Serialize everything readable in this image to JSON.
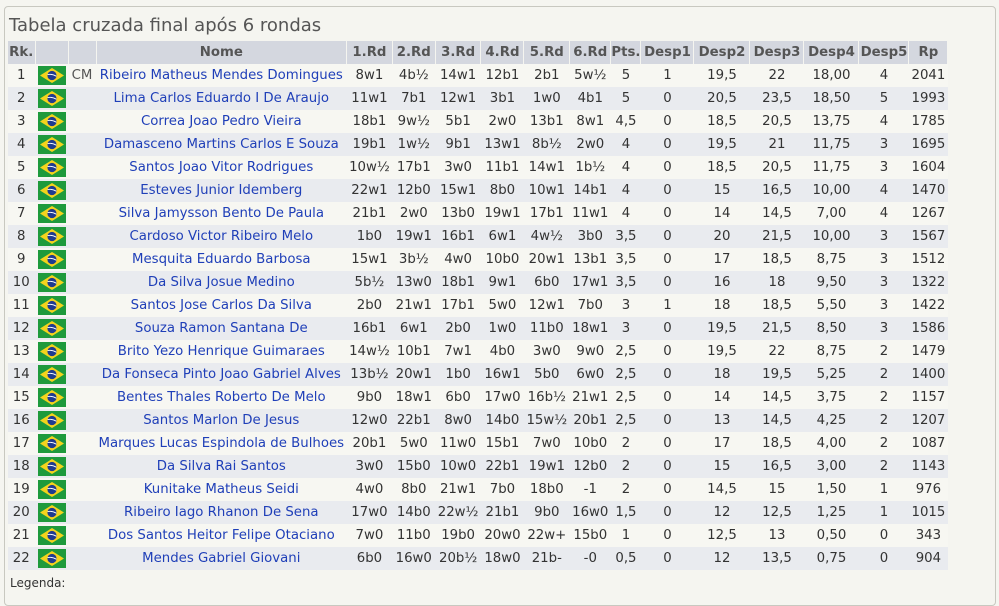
{
  "title": "Tabela cruzada final após 6 rondas",
  "headers": {
    "rank": "Rk.",
    "name": "Nome",
    "r1": "1.Rd",
    "r2": "2.Rd",
    "r3": "3.Rd",
    "r4": "4.Rd",
    "r5": "5.Rd",
    "r6": "6.Rd",
    "pts": "Pts.",
    "d1": "Desp1",
    "d2": "Desp2",
    "d3": "Desp3",
    "d4": "Desp4",
    "d5": "Desp5",
    "rp": "Rp"
  },
  "flag_icon": "brazil-flag-icon",
  "colors": {
    "header_bg": "#d4d7df",
    "link": "#1f3fb8",
    "row_alt": "#e9ebef"
  },
  "rows": [
    {
      "rk": "1",
      "title": "CM",
      "name": "Ribeiro Matheus Mendes Domingues",
      "rounds": [
        "8w1",
        "4b½",
        "14w1",
        "12b1",
        "2b1",
        "5w½"
      ],
      "pts": "5",
      "d1": "1",
      "d2": "19,5",
      "d3": "22",
      "d4": "18,00",
      "d5": "4",
      "rp": "2041"
    },
    {
      "rk": "2",
      "title": "",
      "name": "Lima Carlos Eduardo I De Araujo",
      "rounds": [
        "11w1",
        "7b1",
        "12w1",
        "3b1",
        "1w0",
        "4b1"
      ],
      "pts": "5",
      "d1": "0",
      "d2": "20,5",
      "d3": "23,5",
      "d4": "18,50",
      "d5": "5",
      "rp": "1993"
    },
    {
      "rk": "3",
      "title": "",
      "name": "Correa Joao Pedro Vieira",
      "rounds": [
        "18b1",
        "9w½",
        "5b1",
        "2w0",
        "13b1",
        "8w1"
      ],
      "pts": "4,5",
      "d1": "0",
      "d2": "18,5",
      "d3": "20,5",
      "d4": "13,75",
      "d5": "4",
      "rp": "1785"
    },
    {
      "rk": "4",
      "title": "",
      "name": "Damasceno Martins Carlos E Souza",
      "rounds": [
        "19b1",
        "1w½",
        "9b1",
        "13w1",
        "8b½",
        "2w0"
      ],
      "pts": "4",
      "d1": "0",
      "d2": "19,5",
      "d3": "21",
      "d4": "11,75",
      "d5": "3",
      "rp": "1695"
    },
    {
      "rk": "5",
      "title": "",
      "name": "Santos Joao Vitor Rodrigues",
      "rounds": [
        "10w½",
        "17b1",
        "3w0",
        "11b1",
        "14w1",
        "1b½"
      ],
      "pts": "4",
      "d1": "0",
      "d2": "18,5",
      "d3": "20,5",
      "d4": "11,75",
      "d5": "3",
      "rp": "1604"
    },
    {
      "rk": "6",
      "title": "",
      "name": "Esteves Junior Idemberg",
      "rounds": [
        "22w1",
        "12b0",
        "15w1",
        "8b0",
        "10w1",
        "14b1"
      ],
      "pts": "4",
      "d1": "0",
      "d2": "15",
      "d3": "16,5",
      "d4": "10,00",
      "d5": "4",
      "rp": "1470"
    },
    {
      "rk": "7",
      "title": "",
      "name": "Silva Jamysson Bento De Paula",
      "rounds": [
        "21b1",
        "2w0",
        "13b0",
        "19w1",
        "17b1",
        "11w1"
      ],
      "pts": "4",
      "d1": "0",
      "d2": "14",
      "d3": "14,5",
      "d4": "7,00",
      "d5": "4",
      "rp": "1267"
    },
    {
      "rk": "8",
      "title": "",
      "name": "Cardoso Victor Ribeiro Melo",
      "rounds": [
        "1b0",
        "19w1",
        "16b1",
        "6w1",
        "4w½",
        "3b0"
      ],
      "pts": "3,5",
      "d1": "0",
      "d2": "20",
      "d3": "21,5",
      "d4": "10,00",
      "d5": "3",
      "rp": "1567"
    },
    {
      "rk": "9",
      "title": "",
      "name": "Mesquita Eduardo Barbosa",
      "rounds": [
        "15w1",
        "3b½",
        "4w0",
        "10b0",
        "20w1",
        "13b1"
      ],
      "pts": "3,5",
      "d1": "0",
      "d2": "17",
      "d3": "18,5",
      "d4": "8,75",
      "d5": "3",
      "rp": "1512"
    },
    {
      "rk": "10",
      "title": "",
      "name": "Da Silva Josue Medino",
      "rounds": [
        "5b½",
        "13w0",
        "18b1",
        "9w1",
        "6b0",
        "17w1"
      ],
      "pts": "3,5",
      "d1": "0",
      "d2": "16",
      "d3": "18",
      "d4": "9,50",
      "d5": "3",
      "rp": "1322"
    },
    {
      "rk": "11",
      "title": "",
      "name": "Santos Jose Carlos Da Silva",
      "rounds": [
        "2b0",
        "21w1",
        "17b1",
        "5w0",
        "12w1",
        "7b0"
      ],
      "pts": "3",
      "d1": "1",
      "d2": "18",
      "d3": "18,5",
      "d4": "5,50",
      "d5": "3",
      "rp": "1422"
    },
    {
      "rk": "12",
      "title": "",
      "name": "Souza Ramon Santana De",
      "rounds": [
        "16b1",
        "6w1",
        "2b0",
        "1w0",
        "11b0",
        "18w1"
      ],
      "pts": "3",
      "d1": "0",
      "d2": "19,5",
      "d3": "21,5",
      "d4": "8,50",
      "d5": "3",
      "rp": "1586"
    },
    {
      "rk": "13",
      "title": "",
      "name": "Brito Yezo Henrique Guimaraes",
      "rounds": [
        "14w½",
        "10b1",
        "7w1",
        "4b0",
        "3w0",
        "9w0"
      ],
      "pts": "2,5",
      "d1": "0",
      "d2": "19,5",
      "d3": "22",
      "d4": "8,75",
      "d5": "2",
      "rp": "1479"
    },
    {
      "rk": "14",
      "title": "",
      "name": "Da Fonseca Pinto Joao Gabriel Alves",
      "rounds": [
        "13b½",
        "20w1",
        "1b0",
        "16w1",
        "5b0",
        "6w0"
      ],
      "pts": "2,5",
      "d1": "0",
      "d2": "18",
      "d3": "19,5",
      "d4": "5,25",
      "d5": "2",
      "rp": "1400"
    },
    {
      "rk": "15",
      "title": "",
      "name": "Bentes Thales Roberto De Melo",
      "rounds": [
        "9b0",
        "18w1",
        "6b0",
        "17w0",
        "16b½",
        "21w1"
      ],
      "pts": "2,5",
      "d1": "0",
      "d2": "14",
      "d3": "14,5",
      "d4": "3,75",
      "d5": "2",
      "rp": "1157"
    },
    {
      "rk": "16",
      "title": "",
      "name": "Santos Marlon De Jesus",
      "rounds": [
        "12w0",
        "22b1",
        "8w0",
        "14b0",
        "15w½",
        "20b1"
      ],
      "pts": "2,5",
      "d1": "0",
      "d2": "13",
      "d3": "14,5",
      "d4": "4,25",
      "d5": "2",
      "rp": "1207"
    },
    {
      "rk": "17",
      "title": "",
      "name": "Marques Lucas Espindola de Bulhoes",
      "rounds": [
        "20b1",
        "5w0",
        "11w0",
        "15b1",
        "7w0",
        "10b0"
      ],
      "pts": "2",
      "d1": "0",
      "d2": "17",
      "d3": "18,5",
      "d4": "4,00",
      "d5": "2",
      "rp": "1087"
    },
    {
      "rk": "18",
      "title": "",
      "name": "Da Silva Rai Santos",
      "rounds": [
        "3w0",
        "15b0",
        "10w0",
        "22b1",
        "19w1",
        "12b0"
      ],
      "pts": "2",
      "d1": "0",
      "d2": "15",
      "d3": "16,5",
      "d4": "3,00",
      "d5": "2",
      "rp": "1143"
    },
    {
      "rk": "19",
      "title": "",
      "name": "Kunitake Matheus Seidi",
      "rounds": [
        "4w0",
        "8b0",
        "21w1",
        "7b0",
        "18b0",
        "-1"
      ],
      "pts": "2",
      "d1": "0",
      "d2": "14,5",
      "d3": "15",
      "d4": "1,50",
      "d5": "1",
      "rp": "976"
    },
    {
      "rk": "20",
      "title": "",
      "name": "Ribeiro Iago Rhanon De Sena",
      "rounds": [
        "17w0",
        "14b0",
        "22w½",
        "21b1",
        "9b0",
        "16w0"
      ],
      "pts": "1,5",
      "d1": "0",
      "d2": "12",
      "d3": "12,5",
      "d4": "1,25",
      "d5": "1",
      "rp": "1015"
    },
    {
      "rk": "21",
      "title": "",
      "name": "Dos Santos Heitor Felipe Otaciano",
      "rounds": [
        "7w0",
        "11b0",
        "19b0",
        "20w0",
        "22w+",
        "15b0"
      ],
      "pts": "1",
      "d1": "0",
      "d2": "12,5",
      "d3": "13",
      "d4": "0,50",
      "d5": "0",
      "rp": "343"
    },
    {
      "rk": "22",
      "title": "",
      "name": "Mendes Gabriel Giovani",
      "rounds": [
        "6b0",
        "16w0",
        "20b½",
        "18w0",
        "21b-",
        "-0"
      ],
      "pts": "0,5",
      "d1": "0",
      "d2": "12",
      "d3": "13,5",
      "d4": "0,75",
      "d5": "0",
      "rp": "904"
    }
  ],
  "footer": "Legenda:"
}
